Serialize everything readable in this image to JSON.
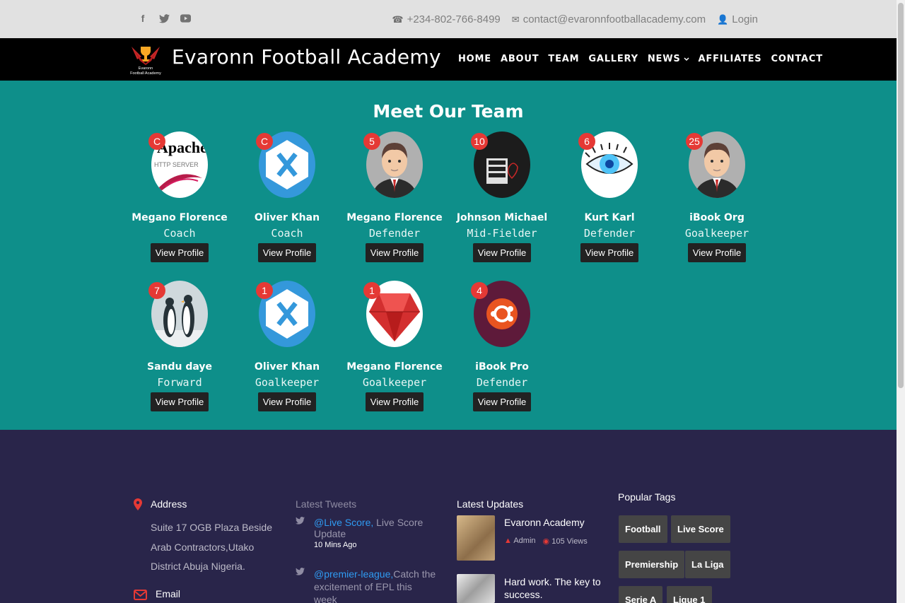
{
  "topbar": {
    "social_icons": [
      "facebook-icon",
      "twitter-icon",
      "youtube-icon"
    ],
    "phone": "+234-802-766-8499",
    "email": "contact@evaronnfootballacademy.com",
    "login": "Login"
  },
  "navbar": {
    "logo_text": "Evaronn Football Academy",
    "brand": "Evaronn Football Academy",
    "items": [
      "HOME",
      "ABOUT",
      "TEAM",
      "GALLERY",
      "NEWS",
      "AFFILIATES",
      "CONTACT"
    ]
  },
  "team": {
    "title": "Meet Our Team",
    "button_label": "View Profile",
    "members": [
      {
        "badge": "C",
        "name": "Megano Florence",
        "role": "Coach",
        "image": "apache-logo"
      },
      {
        "badge": "C",
        "name": "Oliver Khan",
        "role": "Coach",
        "image": "xamarin-logo"
      },
      {
        "badge": "5",
        "name": "Megano Florence",
        "role": "Defender",
        "image": "man-avatar"
      },
      {
        "badge": "10",
        "name": "Johnson Michael",
        "role": "Mid-Fielder",
        "image": "i-hate-nothing-photo"
      },
      {
        "badge": "6",
        "name": "Kurt Karl",
        "role": "Defender",
        "image": "eye-photo"
      },
      {
        "badge": "25",
        "name": "iBook Org",
        "role": "Goalkeeper",
        "image": "man-avatar"
      },
      {
        "badge": "7",
        "name": "Sandu daye",
        "role": "Forward",
        "image": "penguins-photo"
      },
      {
        "badge": "1",
        "name": "Oliver Khan",
        "role": "Goalkeeper",
        "image": "xamarin-logo"
      },
      {
        "badge": "1",
        "name": "Megano Florence",
        "role": "Goalkeeper",
        "image": "ruby-logo"
      },
      {
        "badge": "4",
        "name": "iBook Pro",
        "role": "Defender",
        "image": "ubuntu-logo"
      }
    ]
  },
  "footer": {
    "address_title": "Address",
    "address": "Suite 17 OGB Plaza Beside Arab Contractors,Utako District Abuja Nigeria.",
    "email_title": "Email",
    "tweets_title": "Latest Tweets",
    "tweets": [
      {
        "handle": "@Live Score,",
        "text": " Live Score Update",
        "time": "10 Mins Ago"
      },
      {
        "handle": "@premier-league,",
        "text": "Catch the excitement of EPL this week"
      }
    ],
    "updates_title": "Latest Updates",
    "updates": [
      {
        "title": "Evaronn Academy",
        "author": "Admin",
        "views": "105 Views"
      },
      {
        "title": "Hard work. The key to success."
      }
    ],
    "tags_title": "Popular Tags",
    "tags": [
      "Football",
      "Live Score",
      "Premiership",
      "La Liga",
      "Serie A",
      "Ligue 1"
    ]
  },
  "colors": {
    "team_bg": "#0e8f8a",
    "footer_bg": "#29254a",
    "badge": "#e53935",
    "link": "#2f9bf2"
  }
}
